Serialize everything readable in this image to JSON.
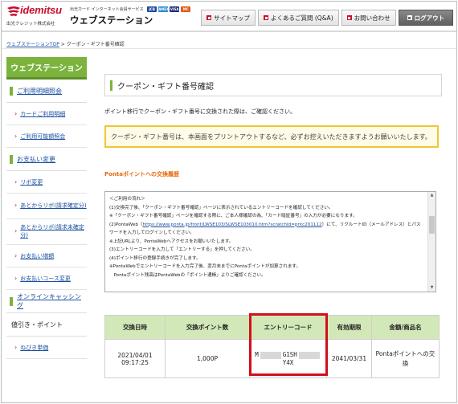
{
  "header": {
    "logo_text": "idemitsu",
    "logo_sub": "出光クレジット株式会社",
    "service_line": "出光カード インターネット会員サービス",
    "cards": [
      {
        "label": "JCB",
        "color": "#1e4aa0"
      },
      {
        "label": "AMEX",
        "color": "#2a8bd1"
      },
      {
        "label": "VISA",
        "color": "#1a2a7a"
      },
      {
        "label": "MC",
        "color": "#e05a1a"
      }
    ],
    "site_title": "ウェブステーション",
    "nav": [
      {
        "label": "サイトマップ"
      },
      {
        "label": "よくあるご質問 (Q&A)"
      },
      {
        "label": "お問い合わせ"
      },
      {
        "label": "ログアウト"
      }
    ]
  },
  "breadcrumb": {
    "home": "ウェブステーションTOP",
    "sep": " > ",
    "current": "クーポン・ギフト番号確認"
  },
  "sidebar": {
    "title": "ウェブステーション",
    "sec1": "ご利用明細照会",
    "sec1_items": [
      "カードご利用明細",
      "ご利用可能額照会"
    ],
    "sec2": "お支払い変更",
    "sec2_items": [
      "リボ変更",
      "あとからリボ(請求確定分)",
      "あとからリボ(請求未確定分)",
      "お支払い増額",
      "お支払いコース変更"
    ],
    "sec3": "オンラインキャッシング",
    "sec4": "値引き・ポイント",
    "sec4_items": [
      "ねびき単価"
    ]
  },
  "main": {
    "title": "クーポン・ギフト番号確認",
    "intro": "ポイント移行でクーポン・ギフト番号に交換された際は、ご確認ください。",
    "notice": "クーポン・ギフト番号は、本画面をプリントアウトするなど、必ずお控えいただきますようお願いいたします。",
    "ponta_heading": "Pontaポイントへの交換履歴",
    "flow": {
      "lines": [
        "＜ご利用の流れ＞",
        "(1)交換完了後、「クーポン・ギフト番号確認」ページに表示されているエントリーコードを確認してください。",
        "※「クーポン・ギフト番号確認」ページを確認する際に、ご本人様確認の為、「カード暗証番号」の入力が必要になります。",
        "(2)PontaWeb（",
        "ワードを入力してログインしてください。",
        "※上記URLより、PontaWebへアクセスをお願いいたします。",
        "(3)エントリーコードを入力して「エントリーする」を押してください。",
        "(4)ポイント移行の登録手続きが完了します。",
        "※PontaWebでエントリーコードを入力完了後、翌月末までにPontaポイントが加算されます。",
        "　Pontaポイント残高はPontaWebの「ポイント通帳」よりご確認ください。"
      ],
      "url": "https://www.ponta.jp/front/LWSE103/SLWSE103010.htm?scratchId=pntc201112",
      "after_url": "）にて、リクルートID（メールアドレス）とパス"
    },
    "table": {
      "headers": [
        "交換日時",
        "交換ポイント数",
        "エントリーコード",
        "有効期限",
        "金額/商品名"
      ],
      "row": {
        "date": "2021/04/01 09:17:25",
        "points": "1,000P",
        "code_parts": [
          "M",
          "G1SH",
          "Y4X"
        ],
        "expiry": "2041/03/31",
        "item": "Pontaポイントへの交換"
      }
    }
  }
}
